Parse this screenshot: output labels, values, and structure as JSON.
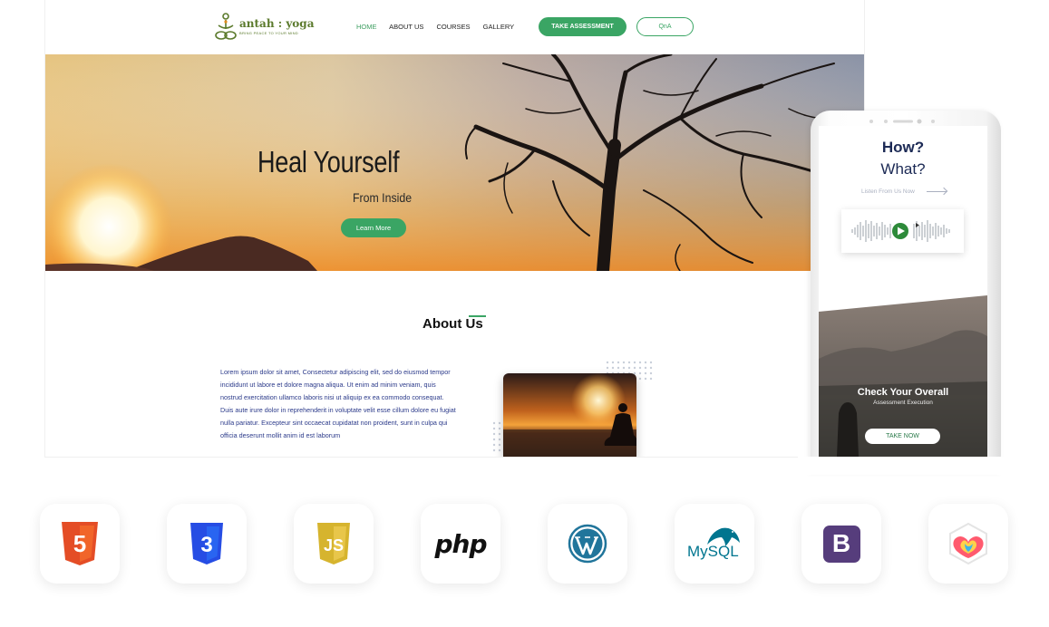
{
  "site": {
    "logo_text": "antah : yoga",
    "logo_tagline": "BRING PEACE TO YOUR MIND",
    "nav": [
      "HOME",
      "ABOUT US",
      "COURSES",
      "GALLERY"
    ],
    "active_nav": "HOME",
    "cta_assessment": "TAKE ASSESSMENT",
    "cta_qna": "QnA"
  },
  "hero": {
    "title": "Heal Yourself",
    "subtitle": "From Inside",
    "button": "Learn More"
  },
  "about": {
    "title": "About Us",
    "body": "Lorem ipsum dolor sit amet, Consectetur adipiscing elit, sed do eiusmod tempor incididunt ut labore et dolore magna aliqua. Ut enim ad minim veniam, quis nostrud exercitation ullamco laboris nisi ut aliquip ex ea commodo consequat. Duis aute irure dolor in reprehenderit in voluptate velit esse cillum dolore eu fugiat nulla pariatur. Excepteur sint occaecat cupidatat non proident, sunt in culpa qui officia deserunt mollit anim id est laborum"
  },
  "phone": {
    "line1": "How?",
    "line2": "What?",
    "listen": "Listen From Us Now",
    "card_title": "Check Your Overall",
    "card_sub": "Assessment Execution",
    "card_button": "TAKE NOW"
  },
  "tech_icons": [
    "html5-icon",
    "css3-icon",
    "javascript-icon",
    "php-icon",
    "wordpress-icon",
    "mysql-icon",
    "bootstrap-icon",
    "craft-icon"
  ],
  "tech_labels": {
    "php": "php",
    "mysql": "MySQL",
    "bootstrap": "B",
    "html": "5",
    "css": "3",
    "js": "JS"
  },
  "colors": {
    "accent_green": "#3aa564",
    "text_navy": "#2b3a8a",
    "html_orange": "#e44d26",
    "css_blue": "#264de4",
    "js_yellow": "#d6b42e",
    "wordpress_blue": "#21759b",
    "bootstrap_purple": "#563d7c"
  }
}
